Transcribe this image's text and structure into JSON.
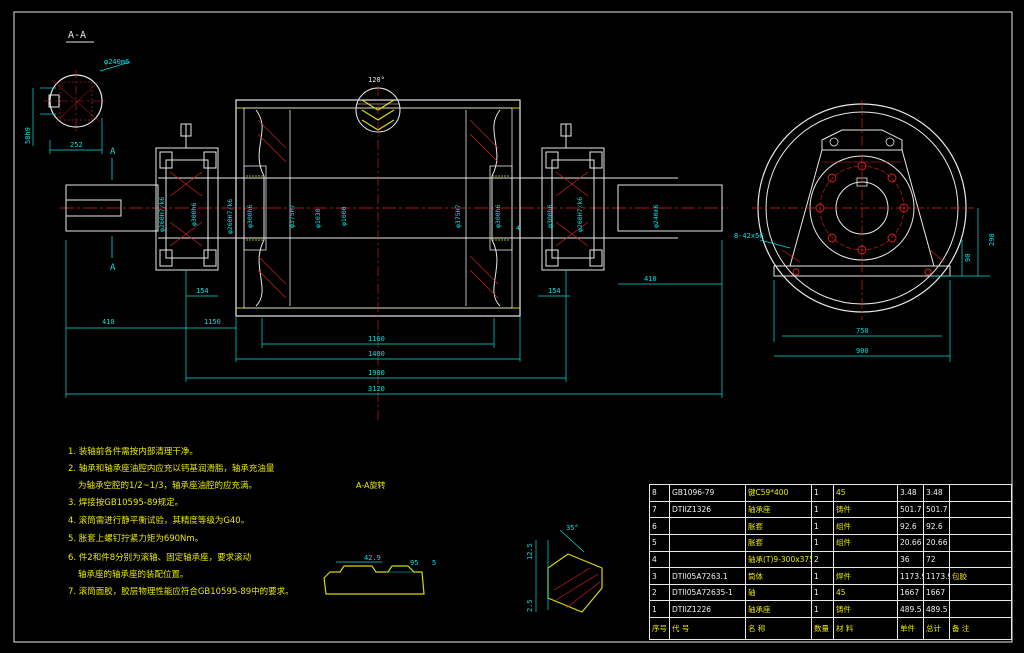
{
  "section_label": "A-A",
  "section_label_bottom": "A-A旋转",
  "cut_marks": [
    "A",
    "A"
  ],
  "dims": {
    "shaft_dia": "φ240m6",
    "key_depth": "58h9",
    "key_len": "252",
    "angle_120": "120°",
    "d_260_left": "φ260H7/k6",
    "d_360_left": "φ300h6",
    "d_260b": "φ260H7/k6",
    "d_300_left": "φ300h6",
    "d_375_left": "φ375H7",
    "d_1030": "φ1030",
    "d_1000": "φ1000",
    "d_375_right": "φ375H7",
    "d_300_right": "φ300h6",
    "d_300_r2": "φ300h6",
    "d_260_right": "φ260H7/k6",
    "d_240_right": "φ240m6",
    "d_4": "4",
    "len_410_left": "410",
    "len_154_left": "154",
    "len_1150": "1150",
    "len_1160": "1160",
    "len_1400": "1400",
    "len_1900": "1900",
    "len_3120": "3120",
    "len_154_right": "154",
    "len_410_right": "410",
    "bolt": "8-42x56",
    "h_290": "290",
    "h_90": "90",
    "w_750": "750",
    "w_900": "900",
    "detail_429": "42.9",
    "detail_95": "95",
    "detail_5": "5",
    "detail_125": "12.5",
    "detail_25": "2.5",
    "detail_35": "35°"
  },
  "notes": [
    "1. 装轴前各件需按内部清理干净。",
    "2. 轴承和轴承座油腔内应充以钙基润滑脂，轴承充油量",
    "为轴承空腔的1/2~1/3，轴承座油腔的应充满。",
    "3. 焊接按GB10595-89规定。",
    "4. 滚筒需进行静平衡试验，其精度等级为G40。",
    "5. 胀套上螺钉拧紧力矩为690Nm。",
    "6. 件2和件8分别为滚轴、固定轴承座，要求滚动",
    "轴承座的轴承座的装配位置。",
    "7. 滚筒面胶，胶层物理性能应符合GB10595-89中的要求。"
  ],
  "bom": {
    "rows": [
      [
        "8",
        "GB1096-79",
        "键C59*400",
        "1",
        "45",
        "3.48",
        "3.48",
        ""
      ],
      [
        "7",
        "DTIIZ1326",
        "轴承座",
        "1",
        "铸件",
        "501.7",
        "501.7",
        ""
      ],
      [
        "6",
        "",
        "胀套",
        "1",
        "组件",
        "92.6",
        "92.6",
        ""
      ],
      [
        "5",
        "",
        "胀套",
        "1",
        "组件",
        "20.66",
        "20.66",
        ""
      ],
      [
        "4",
        "",
        "轴承(T)9-300x375",
        "2",
        "",
        "36",
        "72",
        ""
      ],
      [
        "3",
        "DTII05A7263.1",
        "筒体",
        "1",
        "焊件",
        "1173.9",
        "1173.9",
        "包胶"
      ],
      [
        "2",
        "DTII05A72635-1",
        "轴",
        "1",
        "45",
        "1667",
        "1667",
        ""
      ],
      [
        "1",
        "DTIIZ1226",
        "轴承座",
        "1",
        "铸件",
        "489.5",
        "489.5",
        ""
      ]
    ],
    "header": [
      "序号",
      "代 号",
      "名 称",
      "数量",
      "材 料",
      "单件",
      "总计",
      "备 注"
    ],
    "header_sub": "重 量"
  },
  "colors": {
    "background": "#000000",
    "outline": "#e8e8e8",
    "dimension": "#00e0e0",
    "centerline": "#e02020",
    "hatch": "#e02020",
    "text_yellow": "#e8e800",
    "accent_yellow": "#d8d800"
  }
}
